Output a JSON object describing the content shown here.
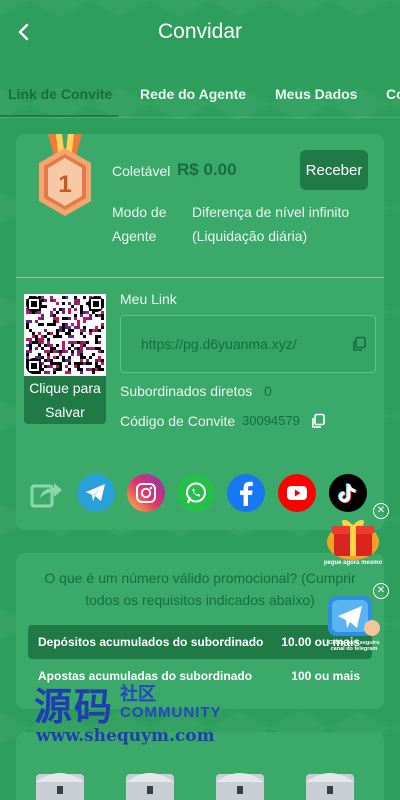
{
  "header": {
    "title": "Convidar",
    "back_icon": "chevron-left-icon"
  },
  "tabs": [
    {
      "label": "Link de Convite",
      "active": true
    },
    {
      "label": "Rede do Agente",
      "active": false
    },
    {
      "label": "Meus Dados",
      "active": false
    },
    {
      "label": "Co",
      "active": false
    }
  ],
  "level_badge": {
    "level": "1"
  },
  "collectable": {
    "label": "Coletável",
    "value": "R$ 0.00"
  },
  "receive_button": {
    "label": "Receber"
  },
  "agent_mode": {
    "label": "Modo de Agente",
    "value": "Diferença de nível infinito (Liquidação diária)"
  },
  "qr": {
    "caption": "Clique para Salvar"
  },
  "invite_link": {
    "title": "Meu Link",
    "url": "https://pg.d6yuanma.xyz/"
  },
  "direct_subordinates": {
    "label": "Subordinados diretos",
    "value": "0"
  },
  "invite_code": {
    "label": "Código de Convite",
    "value": "30094579"
  },
  "share_icons": [
    "share-icon",
    "telegram-icon",
    "instagram-icon",
    "whatsapp-icon",
    "facebook-icon",
    "youtube-icon",
    "tiktok-icon"
  ],
  "promo": {
    "question": "O que é um número válido promocional? (Cumprir todos os requisitos indicados abaixo)",
    "requirements": [
      {
        "label": "Depósitos acumulados do subordinado",
        "value": "10.00 ou mais"
      },
      {
        "label": "Apostas acumuladas do subordinado",
        "value": "100 ou mais"
      }
    ]
  },
  "floating_ads": [
    {
      "caption": "pegue agora mesmo"
    },
    {
      "caption": "Clique para seguiro canal do telegram"
    }
  ],
  "watermark": {
    "main": "源码",
    "sub1": "社区",
    "sub2": "COMMUNITY",
    "url": "www.shequym.com"
  },
  "colors": {
    "background": "#2e9e5c",
    "card": "#3aa96a",
    "dark_green": "#1f7a45",
    "accent_text": "#1a6e3b"
  }
}
